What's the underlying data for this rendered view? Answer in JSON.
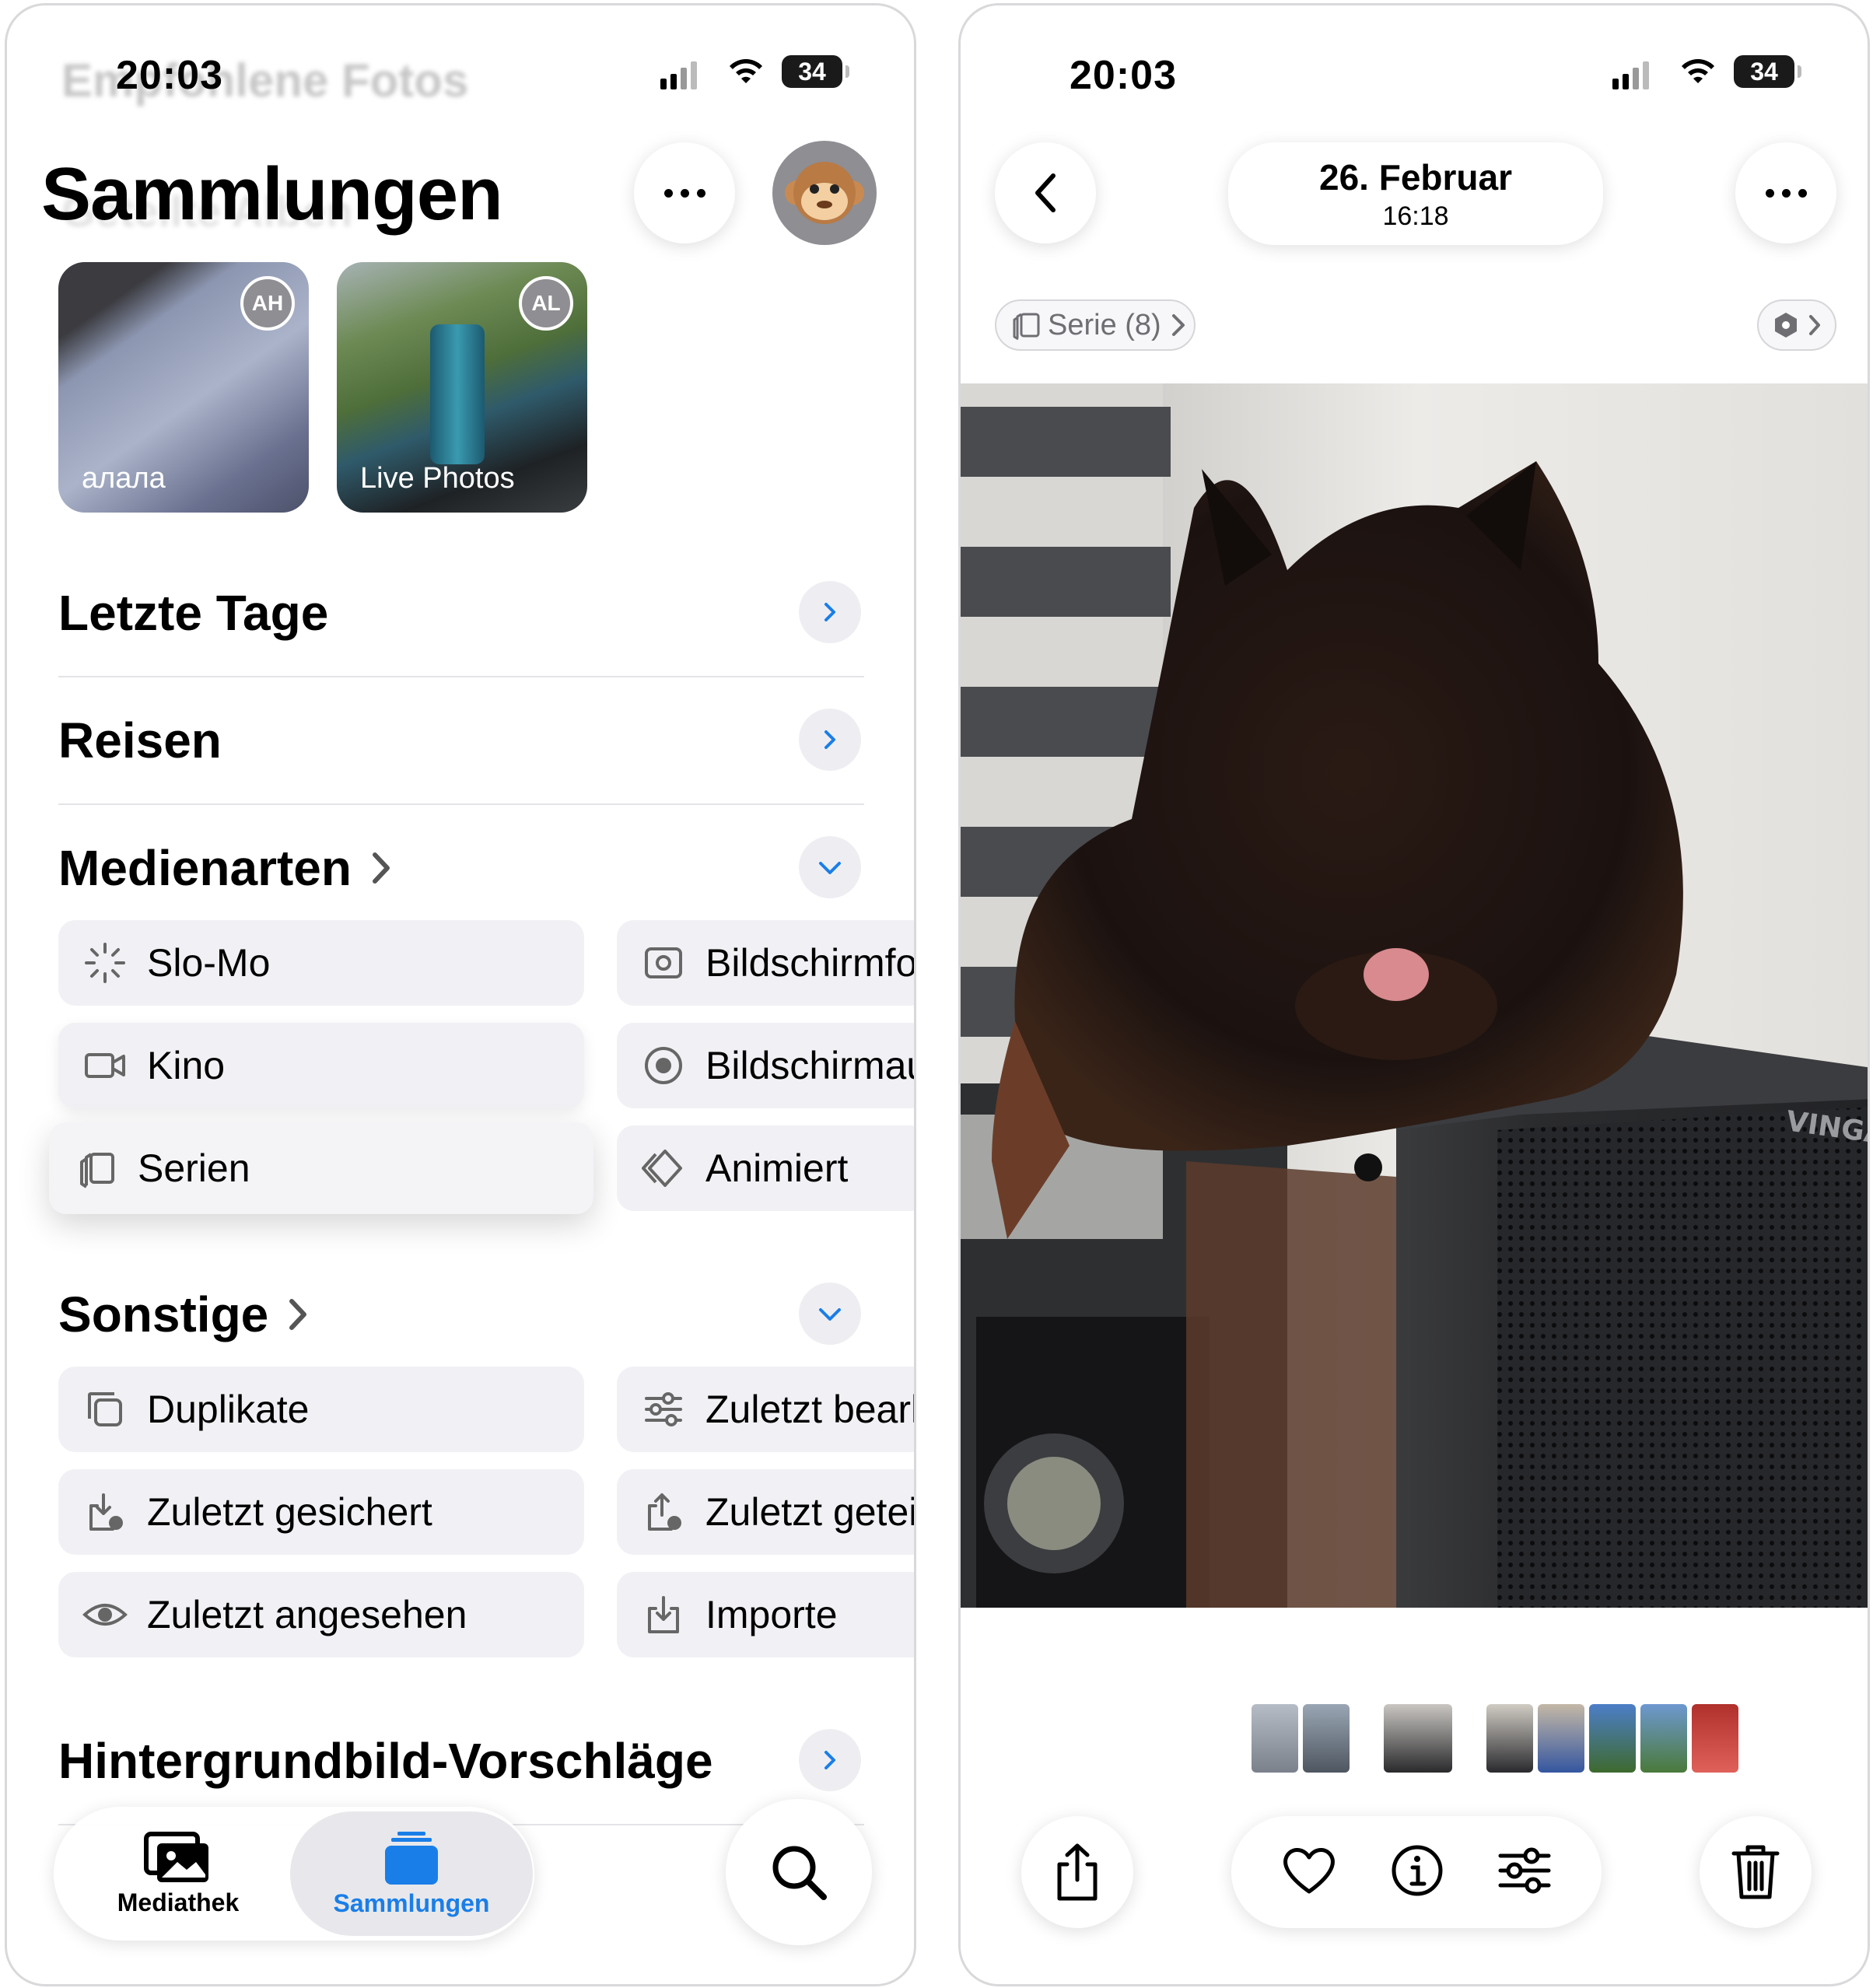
{
  "left": {
    "status": {
      "time": "20:03",
      "battery": "34"
    },
    "blurred_header": "Empfohlene Fotos",
    "blurred_subheader": "Geteilte Alben",
    "title": "Sammlungen",
    "shared_albums": [
      {
        "label": "алала",
        "badge": "AH"
      },
      {
        "label": "Live Photos",
        "badge": "AL"
      }
    ],
    "sections": {
      "recent_days": "Letzte Tage",
      "trips": "Reisen",
      "media_types": "Medienarten",
      "other": "Sonstige",
      "wallpaper": "Hintergrundbild-Vorschläge"
    },
    "media_types": {
      "slomo": "Slo-Mo",
      "screenshots": "Bildschirmfotos",
      "cinematic": "Kino",
      "screen_recordings": "Bildschirmaufnahmen",
      "bursts": "Serien",
      "animated": "Animiert"
    },
    "other_items": {
      "duplicates": "Duplikate",
      "recently_edited": "Zuletzt bearbeitet",
      "recently_saved": "Zuletzt gesichert",
      "recently_shared": "Zuletzt geteilt",
      "recently_viewed": "Zuletzt angesehen",
      "imports": "Importe"
    },
    "tabbar": {
      "library": "Mediathek",
      "collections": "Sammlungen"
    },
    "accent_color": "#1a7ee8"
  },
  "right": {
    "status": {
      "time": "20:03",
      "battery": "34"
    },
    "header": {
      "date": "26. Februar",
      "time": "16:18"
    },
    "burst_label": "Serie (8)",
    "case_label": "VINGA",
    "toolbar": [
      "share-icon",
      "heart-icon",
      "info-icon",
      "adjust-icon",
      "trash-icon"
    ]
  }
}
